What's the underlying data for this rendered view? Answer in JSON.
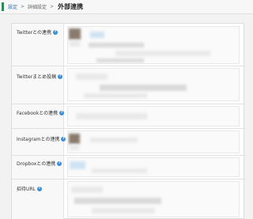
{
  "breadcrumb": {
    "items": [
      "設定",
      "詳細設定"
    ],
    "separator": ">",
    "current": "外部連携"
  },
  "help_icon_glyph": "?",
  "settings": {
    "rows": [
      {
        "label": "Twitterとの連携"
      },
      {
        "label": "Twitterまとめ投稿"
      },
      {
        "label": "Facebookとの連携"
      },
      {
        "label": "Instagramとの連携"
      },
      {
        "label": "Dropboxとの連携"
      },
      {
        "label": "招待URL"
      }
    ]
  },
  "colors": {
    "accent": "#2e8b57",
    "link": "#2f6db5",
    "help_icon": "#3a8fd8"
  }
}
